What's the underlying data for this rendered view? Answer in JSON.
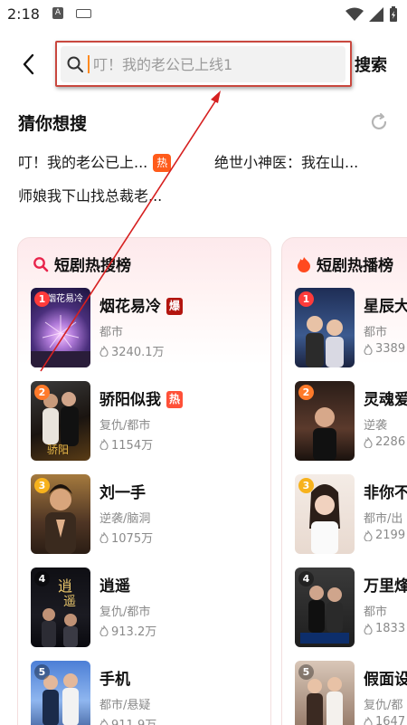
{
  "status": {
    "time": "2:18",
    "a_icon": "A"
  },
  "header": {
    "search_placeholder": "叮！我的老公已上线1",
    "search_button": "搜索"
  },
  "guess": {
    "title": "猜你想搜",
    "items": [
      {
        "text": "叮！我的老公已上...",
        "tag": "热"
      },
      {
        "text": "绝世小神医：我在山..."
      },
      {
        "text": "师娘我下山找总裁老..."
      }
    ]
  },
  "hot_search": {
    "title": "短剧热搜榜",
    "items": [
      {
        "rank": "1",
        "title": "烟花易冷",
        "badge": "爆",
        "genre": "都市",
        "heat": "3240.1万",
        "poster_text": "烟花易冷"
      },
      {
        "rank": "2",
        "title": "骄阳似我",
        "badge": "热",
        "genre": "复仇/都市",
        "heat": "1154万"
      },
      {
        "rank": "3",
        "title": "刘一手",
        "genre": "逆袭/脑洞",
        "heat": "1075万"
      },
      {
        "rank": "4",
        "title": "逍遥",
        "genre": "复仇/都市",
        "heat": "913.2万"
      },
      {
        "rank": "5",
        "title": "手机",
        "genre": "都市/悬疑",
        "heat": "911.9万"
      }
    ]
  },
  "hot_play": {
    "title": "短剧热播榜",
    "items": [
      {
        "rank": "1",
        "title": "星辰大",
        "genre": "都市",
        "heat": "3389"
      },
      {
        "rank": "2",
        "title": "灵魂爱",
        "genre": "逆袭",
        "heat": "2286"
      },
      {
        "rank": "3",
        "title": "非你不",
        "genre": "都市/出",
        "heat": "2199"
      },
      {
        "rank": "4",
        "title": "万里烽",
        "genre": "都市",
        "heat": "1833"
      },
      {
        "rank": "5",
        "title": "假面设",
        "genre": "复仇/都",
        "heat": "1647"
      }
    ]
  },
  "colors": {
    "accent": "#ff5b1a",
    "highlight_border": "#c9483f",
    "arrow": "#d62020"
  }
}
